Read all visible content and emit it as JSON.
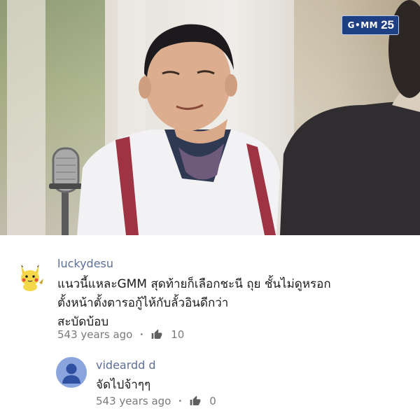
{
  "video": {
    "channel_logo": {
      "text": "G•MM",
      "number": "25"
    }
  },
  "comments": [
    {
      "author": "luckydesu",
      "avatar_icon": "pikachu-avatar-icon",
      "lines": [
        "แนวนี้แหละGMM สุดท้ายก็เลือกชะนี ถุย ชั้นไม่ดูหรอก",
        "ตั้งหน้าตั้งตารอกู้ไห้กับลั้วอินดีกว่า",
        "สะบัดบ้อบ"
      ],
      "time": "543 years ago",
      "likes": "10"
    },
    {
      "author": "videardd d",
      "avatar_icon": "default-user-avatar-icon",
      "lines": [
        "จัดไปจ้าๆๆ"
      ],
      "time": "543 years ago",
      "likes": "0"
    }
  ],
  "colors": {
    "author": "#5c6f96",
    "meta": "#7a7a7a",
    "logo_bg": "#1e3f84",
    "default_avatar_bg": "#8aa4de"
  }
}
